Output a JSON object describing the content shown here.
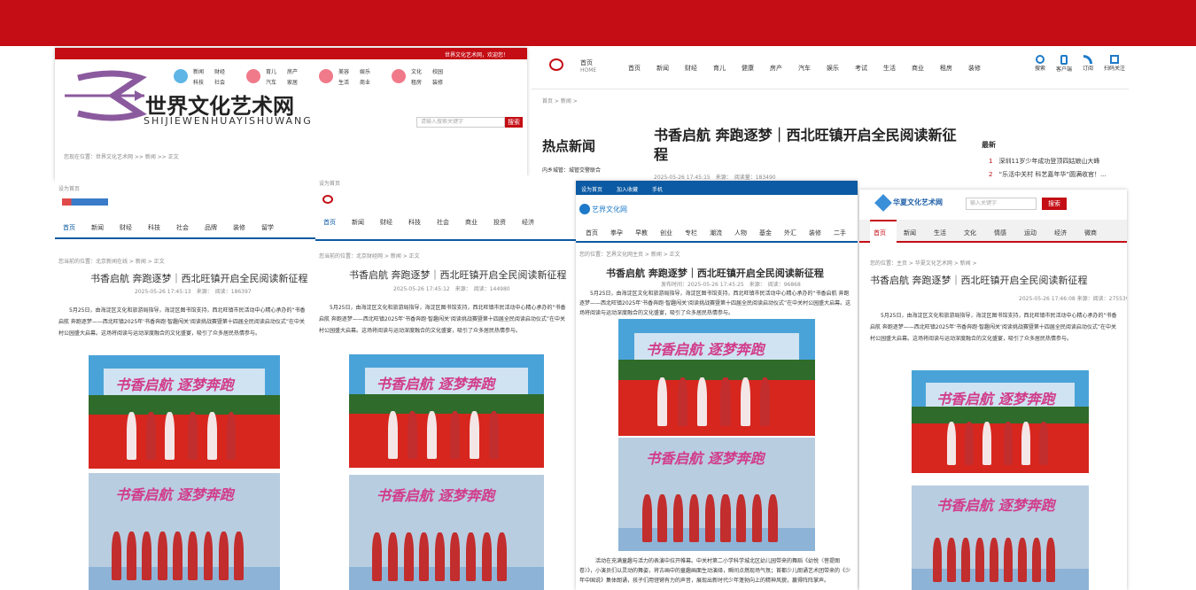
{
  "colors": {
    "brand_red": "#c40d14",
    "blue": "#0b5aa3",
    "purple": "#8b5a9e"
  },
  "p1": {
    "topbar_text": "世界文化艺术网，欢迎您！",
    "logo_cn": "世界文化艺术网",
    "logo_pinyin": "SHIJIEWENHUAYISHUWANG",
    "nav_groups": [
      {
        "icon": "新闻",
        "items": [
          "新闻",
          "财经",
          "科技",
          "社会"
        ]
      },
      {
        "icon": "育儿",
        "items": [
          "育儿",
          "房产",
          "汽车",
          "家居"
        ]
      },
      {
        "icon": "美容",
        "items": [
          "美容",
          "娱乐",
          "生活",
          "商业"
        ]
      },
      {
        "icon": "文化",
        "items": [
          "文化",
          "校园",
          "租房",
          "装修"
        ]
      }
    ],
    "search_placeholder": "请输入搜索关键字",
    "search_button": "搜索",
    "breadcrumb": "您现在位置：世界文化艺术网 >> 新闻 >> 正文"
  },
  "p2": {
    "nav_label": "首页",
    "home_en": "HOME",
    "nav": [
      "首页",
      "新闻",
      "财经",
      "育儿",
      "健康",
      "房产",
      "汽车",
      "娱乐",
      "考试",
      "生活",
      "商业",
      "租房",
      "装修"
    ],
    "tools": [
      "搜索",
      "客户端",
      "订阅",
      "扫码关注"
    ],
    "breadcrumb": "首页 > 新闻 >",
    "title": "书香启航 奔跑逐梦｜西北旺镇开启全民阅读新征程",
    "meta": "2025-05-26 17:45:15　来源：　阅读量：183490",
    "hot": "热点新闻",
    "hot_item": "内乡城管：城管交警联合",
    "latest": "最新",
    "latest_items": [
      {
        "n": "1",
        "text": "深圳11岁少年成功登顶四姑娘山大峰"
      },
      {
        "n": "2",
        "text": "“乐活中关村 科艺嘉年华”圆满收官！..."
      }
    ]
  },
  "p3": {
    "top": "设为首页",
    "nav": [
      "首页",
      "新闻",
      "财经",
      "科技",
      "社会",
      "品牌",
      "装修",
      "留学"
    ],
    "breadcrumb": "您当前的位置：北京新闻在线 > 新闻 > 正文",
    "title": "书香启航 奔跑逐梦｜西北旺镇开启全民阅读新征程",
    "meta": "2025-05-26 17:45:13　来源：　阅读：186397",
    "body": "5月25日，由海淀区文化和旅游局指导，海淀区图书馆支持，西北旺镇市民活动中心精心承办的“书香启航 奔跑逐梦——西北旺镇2025年‘书香奔跑·智趣闯关’阅读挑战赛暨第十四届全民阅读启动仪式”在中关村公园盛大启幕。这场将阅读与运动深度融合的文化盛宴，吸引了众多居民热情参与。"
  },
  "p4": {
    "top": "设为首页",
    "nav": [
      "首页",
      "新闻",
      "财经",
      "科技",
      "社会",
      "商业",
      "投资",
      "经济"
    ],
    "breadcrumb": "您当前的位置：北京财经网 > 新闻 > 正文",
    "title": "书香启航 奔跑逐梦｜西北旺镇开启全民阅读新征程",
    "meta": "2025-05-26 17:45:12　来源：　阅读：144980",
    "body": "5月25日，由海淀区文化和旅游局指导，海淀区图书馆支持，西北旺镇市民活动中心精心承办的“书香启航 奔跑逐梦——西北旺镇2025年‘书香奔跑·智趣闯关’阅读挑战赛暨第十四届全民阅读启动仪式”在中关村公园盛大启幕。这场将阅读与运动深度融合的文化盛宴，吸引了众多居民热情参与。"
  },
  "p5": {
    "top": [
      "设为首页",
      "加入收藏",
      "手机"
    ],
    "logo": "艺界文化网",
    "nav": [
      "首页",
      "拳孕",
      "早教",
      "创业",
      "专栏",
      "潮流",
      "人物",
      "基金",
      "外汇",
      "装修",
      "二手"
    ],
    "breadcrumb": "您的位置：艺界文化网主页 > 新闻 > 正文",
    "title": "书香启航 奔跑逐梦｜西北旺镇开启全民阅读新征程",
    "meta": "发布时间：2025-05-26 17:45:25　来源：　阅读：96868",
    "body": "5月25日，由海淀区文化和旅游局指导，海淀区图书馆支持，西北旺镇市民活动中心精心承办的“书香启航 奔跑逐梦——西北旺镇2025年‘书香奔跑·智趣闯关’阅读挑战赛暨第十四届全民阅读启动仪式”在中关村公园盛大启幕。这场将阅读与运动深度融合的文化盛宴，吸引了众多居民热情参与。",
    "caption": "活动在充满童趣与活力的表演中拉开帷幕。中关村第二小学科学城北区幼儿园带来的舞蹈《幼悦〈菩提图卷〉》，小演员们以灵动的舞姿，将古画中的童趣画面生动演绎，瞬间点燃现场气氛；首都少儿朗诵艺术团带来的《少年中国说》集体朗诵，孩子们用铿锵有力的声音，展现出新时代少年蓬勃向上的精神风貌，赢得阵阵掌声。"
  },
  "p6": {
    "logo": "华夏文化艺术网",
    "search_placeholder": "输入关键字",
    "search_button": "搜索",
    "nav": [
      "首页",
      "新闻",
      "生活",
      "文化",
      "情感",
      "运动",
      "经济",
      "微商"
    ],
    "breadcrumb": "您的位置：主页 > 华夏文化艺术网 > 新闻 >",
    "title": "书香启航 奔跑逐梦｜西北旺镇开启全民阅读新征程",
    "meta": "2025-05-26 17:46:08 来源：阅读：275539",
    "body": "5月25日，由海淀区文化和旅游局指导，海淀区图书馆支持，西北旺镇市民活动中心精心承办的“书香启航 奔跑逐梦——西北旺镇2025年‘书香奔跑·智趣闯关’阅读挑战赛暨第十四届全民阅读启动仪式”在中关村公园盛大启幕。这场将阅读与运动深度融合的文化盛宴，吸引了众多居民热情参与。"
  },
  "photo_text": "书香启航 逐梦奔跑"
}
